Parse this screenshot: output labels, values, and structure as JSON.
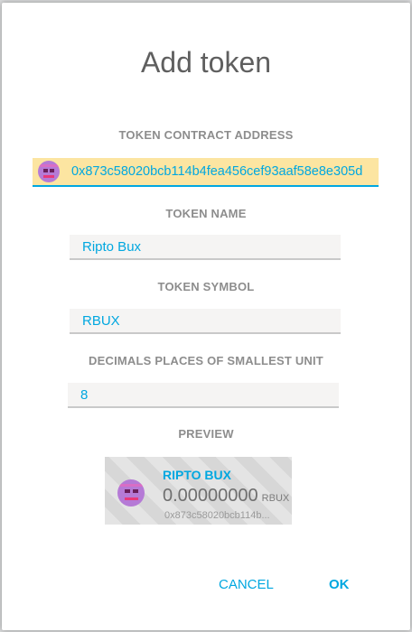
{
  "dialog": {
    "title": "Add token",
    "address_label": "TOKEN CONTRACT ADDRESS",
    "address_value": "0x873c58020bcb114b4fea456cef93aaf58e8e305d",
    "name_label": "TOKEN NAME",
    "name_value": "Ripto Bux",
    "symbol_label": "TOKEN SYMBOL",
    "symbol_value": "RBUX",
    "decimals_label": "DECIMALS PLACES OF SMALLEST UNIT",
    "decimals_value": "8",
    "preview_label": "PREVIEW"
  },
  "preview": {
    "token_name": "RIPTO BUX",
    "balance": "0.00000000",
    "symbol": "RBUX",
    "address": "0x873c58020bcb114b..."
  },
  "buttons": {
    "cancel": "CANCEL",
    "ok": "OK"
  },
  "colors": {
    "accent": "#00a7e0",
    "address_highlight": "#fce5a1",
    "identicon": "#b57ad6"
  },
  "icons": {
    "identicon": "token-identicon-icon"
  }
}
